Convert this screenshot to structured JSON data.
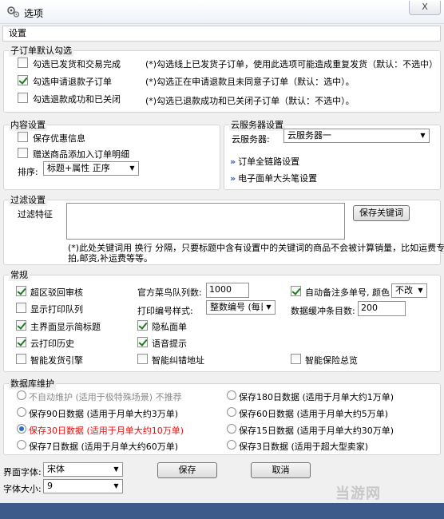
{
  "window": {
    "title": "选项",
    "close_label": "X"
  },
  "header": {
    "title": "设置"
  },
  "sub_order": {
    "legend": "子订单默认勾选",
    "options": [
      {
        "label": "勾选已发货和交易完成",
        "checked": false,
        "note": "(*)勾选线上已发货子订单，使用此选项可能造成重复发货（默认：不选中）"
      },
      {
        "label": "勾选申请退款子订单",
        "checked": true,
        "note": "(*)勾选正在申请退款且未同意子订单（默认：选中）。"
      },
      {
        "label": "勾选退款成功和已关闭",
        "checked": false,
        "note": "(*)勾选已退款成功和已关闭子订单（默认：不选中）。"
      }
    ]
  },
  "content": {
    "legend": "内容设置",
    "save_discount": "保存优惠信息",
    "gift_add": "赠送商品添加入订单明细",
    "sort_label": "排序:",
    "sort_value": "标题+属性 正序"
  },
  "cloud": {
    "legend": "云服务器设置",
    "server_label": "云服务器:",
    "server_value": "云服务器一",
    "link_full": "订单全链路设置",
    "link_eface": "电子面单大头笔设置"
  },
  "filter": {
    "legend": "过滤设置",
    "label": "过滤特征",
    "input_value": "",
    "save_btn": "保存关键词",
    "note_line1": "(*)此处关键词用 换行 分隔，只要标题中含有设置中的关键词的商品不会被计算销量，比如运费专",
    "note_line2": "拍,邮资,补运费等等。"
  },
  "general": {
    "legend": "常规",
    "super_return": "超区驳回审核",
    "show_print_queue": "显示打印队列",
    "main_show_title": "主界面显示简标题",
    "cloud_print_history": "云打印历史",
    "smart_ship_engine": "智能发货引擎",
    "cainiao_queue_label": "官方菜鸟队列数:",
    "cainiao_queue_value": "1000",
    "print_no_style_label": "打印编号样式:",
    "print_no_style_value": "整数编号 (每日",
    "privacy_waybill": "隐私面单",
    "voice_prompt": "语音提示",
    "smart_address": "智能纠错地址",
    "auto_remark": "自动备注多单号, 颜色",
    "color_value": "不改",
    "data_buffer_label": "数据缓冲条目数:",
    "data_buffer_value": "200",
    "smart_insurance": "智能保险总览"
  },
  "database": {
    "legend": "数据库维护",
    "options": [
      {
        "label": "不自动维护 (适用于极特殊场景) 不推荐",
        "style": "gray",
        "checked": false
      },
      {
        "label": "保存180日数据 (适用于月单大约1万单)",
        "style": "normal",
        "checked": false
      },
      {
        "label": "保存90日数据 (适用于月单大约3万单)",
        "style": "normal",
        "checked": false
      },
      {
        "label": "保存60日数据 (适用于月单大约5万单)",
        "style": "normal",
        "checked": false
      },
      {
        "label": "保存30日数据 (适用于月单大约10万单)",
        "style": "red",
        "checked": true
      },
      {
        "label": "保存15日数据 (适用于月单大约30万单)",
        "style": "normal",
        "checked": false
      },
      {
        "label": "保存7日数据 (适用于月单大约60万单)",
        "style": "normal",
        "checked": false
      },
      {
        "label": "保存3日数据 (适用于超大型卖家)",
        "style": "normal",
        "checked": false
      }
    ]
  },
  "footer": {
    "font_label": "界面字体:",
    "font_value": "宋体",
    "size_label": "字体大小:",
    "size_value": "9",
    "save_btn": "保存",
    "cancel_btn": "取消"
  },
  "watermark": "当游网"
}
